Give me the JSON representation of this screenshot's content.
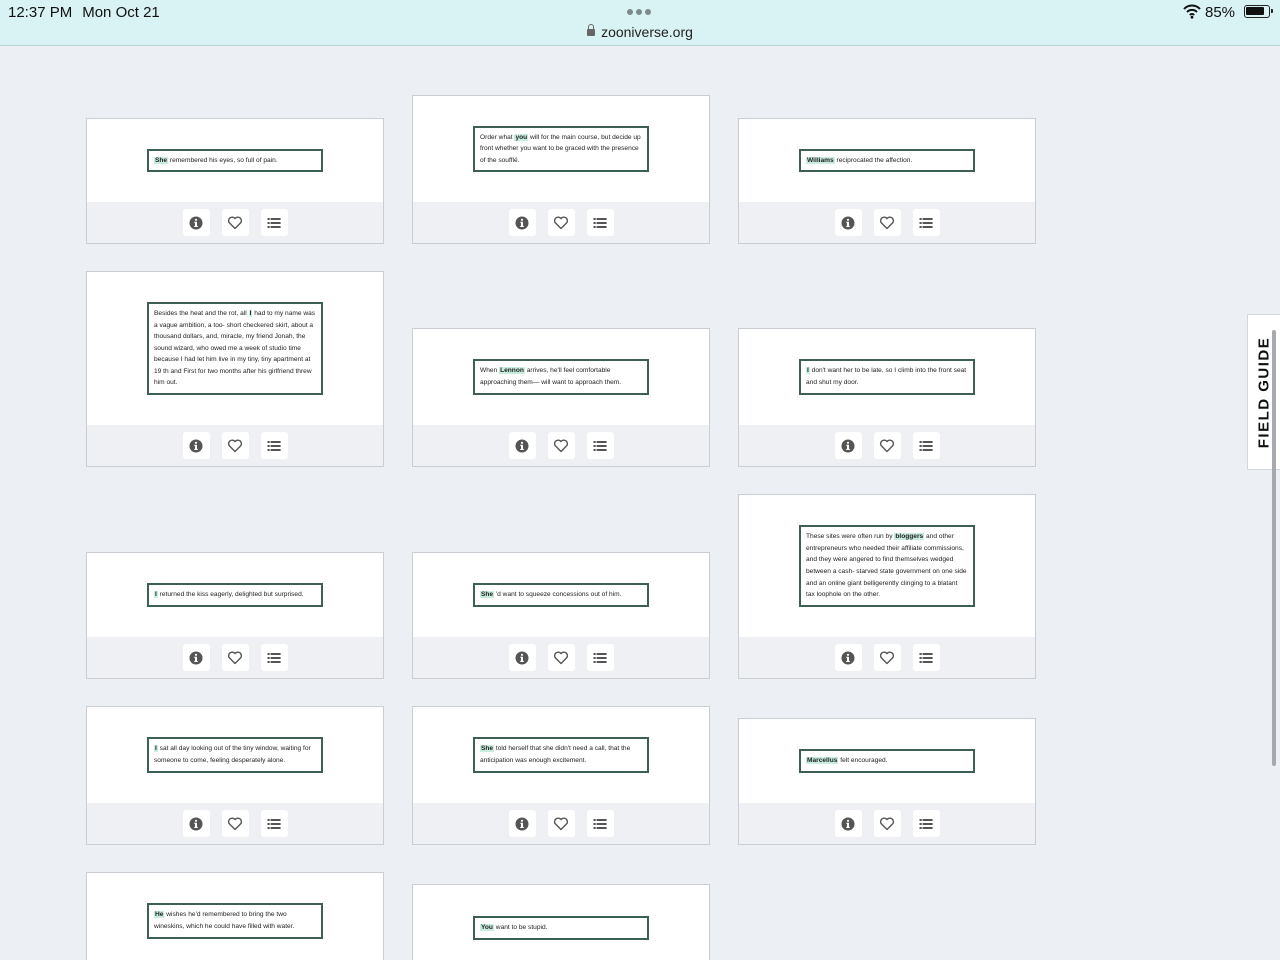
{
  "status_bar": {
    "time": "12:37 PM",
    "date": "Mon Oct 21",
    "battery": "85%"
  },
  "browser": {
    "url": "zooniverse.org"
  },
  "field_guide": {
    "label": "FIELD GUIDE"
  },
  "icons": {
    "info": "info-icon",
    "favorite": "heart-icon",
    "collections": "list-icon"
  },
  "colors": {
    "highlight": "#c8ecdd",
    "sentence_border": "#3d5f55",
    "background": "#eceff3",
    "status_bar": "#d9f2f4"
  },
  "cards": [
    {
      "parts": [
        {
          "t": "She",
          "hl": true
        },
        {
          "t": " remembered his eyes, so full of pain."
        }
      ]
    },
    {
      "parts": [
        {
          "t": "Order what "
        },
        {
          "t": "you",
          "hl": true
        },
        {
          "t": " will for the main course, but decide up front whether you want to be graced with the presence of the soufflé."
        }
      ]
    },
    {
      "parts": [
        {
          "t": "Williams",
          "hl": true
        },
        {
          "t": " reciprocated the affection."
        }
      ]
    },
    {
      "parts": [
        {
          "t": "Besides the heat and the rot, all "
        },
        {
          "t": "I",
          "hl": true
        },
        {
          "t": " had to my name was a vague ambition, a too- short checkered skirt, about a thousand dollars, and, miracle, my friend Jonah, the sound wizard, who owed me a week of studio time because I had let him live in my tiny, tiny apartment at 19 th and First for two months after his girlfriend threw him out."
        }
      ]
    },
    {
      "parts": [
        {
          "t": "When "
        },
        {
          "t": "Lennon",
          "hl": true
        },
        {
          "t": " arrives, he'll feel comfortable approaching them— will want to approach them."
        }
      ]
    },
    {
      "parts": [
        {
          "t": "I",
          "hl": true
        },
        {
          "t": " don't want her to be late, so I climb into the front seat and shut my door."
        }
      ]
    },
    {
      "parts": [
        {
          "t": "I",
          "hl": true
        },
        {
          "t": " returned the kiss eagerly, delighted but surprised."
        }
      ]
    },
    {
      "parts": [
        {
          "t": "She",
          "hl": true
        },
        {
          "t": " 'd want to squeeze concessions out of him."
        }
      ]
    },
    {
      "parts": [
        {
          "t": "These sites were often run by "
        },
        {
          "t": "bloggers",
          "hl": true
        },
        {
          "t": " and other entrepreneurs who needed their affiliate commissions, and they were angered to find themselves wedged between a cash- starved state government on one side and an online giant belligerently clinging to a blatant tax loophole on the other."
        }
      ]
    },
    {
      "parts": [
        {
          "t": "I",
          "hl": true
        },
        {
          "t": " sat all day looking out of the tiny window, waiting for someone to come, feeling desperately alone."
        }
      ]
    },
    {
      "parts": [
        {
          "t": "She",
          "hl": true
        },
        {
          "t": " told herself that she didn't need a call, that the anticipation was enough excitement."
        }
      ]
    },
    {
      "parts": [
        {
          "t": "Marcellus",
          "hl": true
        },
        {
          "t": " felt encouraged."
        }
      ]
    },
    {
      "parts": [
        {
          "t": "He",
          "hl": true
        },
        {
          "t": " wishes he'd remembered to bring the two wineskins, which he could have filled with water."
        }
      ]
    },
    {
      "parts": [
        {
          "t": "You",
          "hl": true
        },
        {
          "t": " want to be stupid."
        }
      ]
    }
  ]
}
